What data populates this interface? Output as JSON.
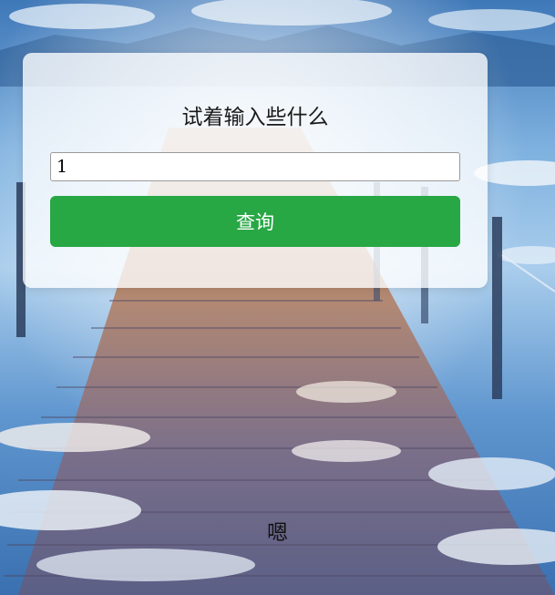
{
  "card": {
    "title": "试着输入些什么"
  },
  "search": {
    "value": "1",
    "placeholder": ""
  },
  "buttons": {
    "query_label": "查询"
  },
  "result": {
    "text": "嗯"
  },
  "colors": {
    "button": "#28a745",
    "card_bg": "rgba(255,255,255,0.78)"
  }
}
